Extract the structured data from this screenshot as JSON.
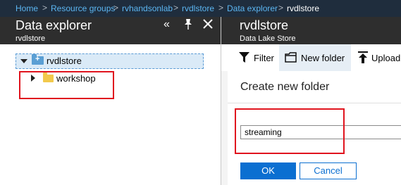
{
  "breadcrumb": {
    "items": [
      "Home",
      "Resource groups",
      "rvhandsonlab",
      "rvdlstore",
      "Data explorer",
      "rvdlstore"
    ],
    "separator": ">"
  },
  "left_blade": {
    "title": "Data explorer",
    "subtitle": "rvdlstore",
    "icons": [
      "collapse-icon",
      "pin-icon",
      "close-icon"
    ]
  },
  "tree": {
    "root": {
      "label": "rvdlstore",
      "expanded": true
    },
    "children": [
      {
        "label": "workshop",
        "expanded": false
      }
    ]
  },
  "right_blade": {
    "title": "rvdlstore",
    "subtitle": "Data Lake Store"
  },
  "toolbar": {
    "filter_label": "Filter",
    "new_folder_label": "New folder",
    "upload_label": "Upload"
  },
  "dialog": {
    "title": "Create new folder",
    "folder_name_value": "streaming",
    "ok_label": "OK",
    "cancel_label": "Cancel"
  },
  "colors": {
    "breadcrumb_bg": "#1f2d3d",
    "link": "#5cb6f2",
    "blade_header_bg": "#2e2e2e",
    "primary": "#0b6fd1",
    "highlight_box": "#e0141e",
    "tree_selected_bg": "#daeaf7"
  }
}
